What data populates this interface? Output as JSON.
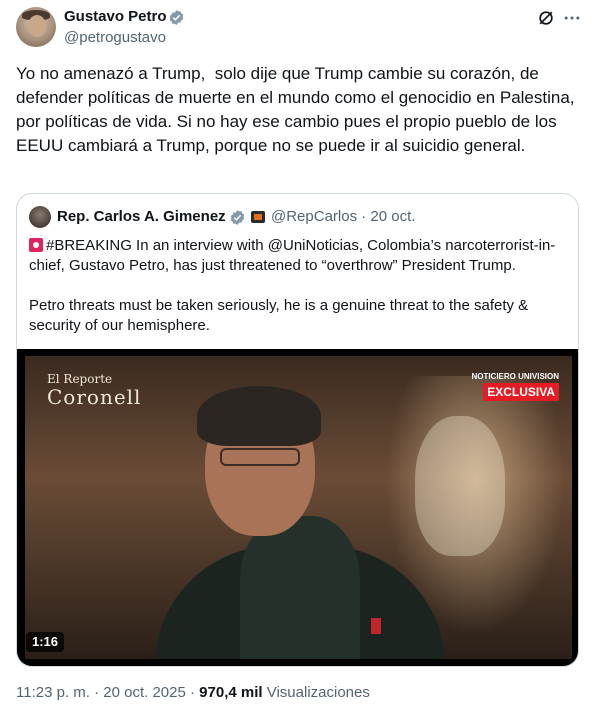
{
  "author": {
    "name": "Gustavo Petro",
    "handle": "@petrogustavo"
  },
  "tweet": {
    "text": "Yo no amenazó a Trump,  solo dije que Trump cambie su corazón, de defender políticas de muerte en el mundo como el genocidio en Palestina, por políticas de vida. Si no hay ese cambio pues el propio pueblo de los EEUU cambiará a Trump, porque no se puede ir al suicidio general."
  },
  "quote": {
    "name": "Rep. Carlos A. Gimenez",
    "handle_date": "@RepCarlos · 20 oct.",
    "line1": "#BREAKING In an interview with @UniNoticias, Colombia’s narcoterrorist-in-chief, Gustavo Petro, has just threatened to “overthrow” President Trump.",
    "line2": "Petro threats must be taken seriously, he is a genuine threat to the safety & security of our hemisphere.",
    "video": {
      "overlay_line1": "El Reporte",
      "overlay_line2": "Coronell",
      "badge_top": "NOTICIERO UNIVISION",
      "badge_label": "EXCLUSIVA",
      "duration": "1:16"
    }
  },
  "meta": {
    "time_date": "11:23 p. m. · 20 oct. 2025 · ",
    "views_count": "970,4 mil",
    "views_label": " Visualizaciones"
  },
  "icons": {
    "verified": "verified-badge-icon",
    "grok": "grok-icon",
    "more": "more-icon"
  },
  "colors": {
    "primary_text": "#0f1419",
    "secondary_text": "#536471",
    "verified": "#829aab",
    "border": "#cfd9de",
    "alert": "#e0245e"
  }
}
